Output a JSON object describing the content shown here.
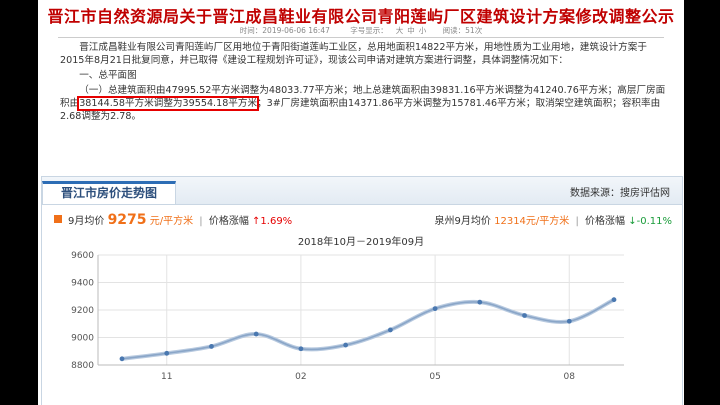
{
  "article": {
    "title": "晋江市自然资源局关于晋江成昌鞋业有限公司青阳莲屿厂区建筑设计方案修改调整公示",
    "time_text": "时间：2019-06-06 16:47",
    "font_label": "字号显示：",
    "font_sizes": [
      "大",
      "中",
      "小"
    ],
    "views_text": "阅读：51次",
    "para1": "晋江成昌鞋业有限公司青阳莲屿厂区用地位于青阳街道莲屿工业区，总用地面积14822平方米，用地性质为工业用地，建筑设计方案于2015年8月21日批复同意，并已取得《建设工程规划许可证》，现该公司申请对建筑方案进行调整，具体调整情况如下：",
    "para2": "一、总平面图",
    "para3_a": "（一）总建筑面积由47995.52平方米调整为48033.77平方米；地上总建筑面积由39831.16平方米调整为41240.76平方米；高层厂房面积由",
    "para3_hl": "38144.58平方米调整为39554.18平方米",
    "para3_b": "；3#厂房建筑面积由14371.86平方米调整为15781.46平方米；取消架空建筑面积；容积率由2.68调整为2.78。"
  },
  "widget": {
    "tab_title": "晋江市房价走势图",
    "source": "数据来源：搜房评估网",
    "local": {
      "month_label": "9月均价",
      "price": "9275",
      "unit": "元/平方米",
      "change_label": "价格涨幅",
      "change": "↑1.69%"
    },
    "compare": {
      "label": "泉州9月均价",
      "price": "12314",
      "unit": "元/平方米",
      "change_label": "价格涨幅",
      "change": "↓-0.11%"
    },
    "colors": {
      "accent": "#f07019",
      "line": "#8aa6c8",
      "point": "#4a78b0",
      "up": "#e60000",
      "down": "#1a9c3a"
    }
  },
  "chart_data": {
    "type": "line",
    "title": "2018年10月－2019年09月",
    "x": [
      "2018-10",
      "2018-11",
      "2018-12",
      "2019-01",
      "2019-02",
      "2019-03",
      "2019-04",
      "2019-05",
      "2019-06",
      "2019-07",
      "2019-08",
      "2019-09"
    ],
    "x_tick_labels": [
      {
        "x": "2018-11",
        "label": "11"
      },
      {
        "x": "2019-02",
        "label": "02"
      },
      {
        "x": "2019-05",
        "label": "05"
      },
      {
        "x": "2019-08",
        "label": "08"
      }
    ],
    "series": [
      {
        "values": [
          8845,
          8885,
          8935,
          9025,
          8918,
          8945,
          9055,
          9210,
          9257,
          9160,
          9118,
          9275
        ]
      }
    ],
    "y_ticks": [
      8800,
      9000,
      9200,
      9400,
      9600
    ],
    "ylim": [
      8800,
      9600
    ],
    "grid": true,
    "legend": "none"
  }
}
